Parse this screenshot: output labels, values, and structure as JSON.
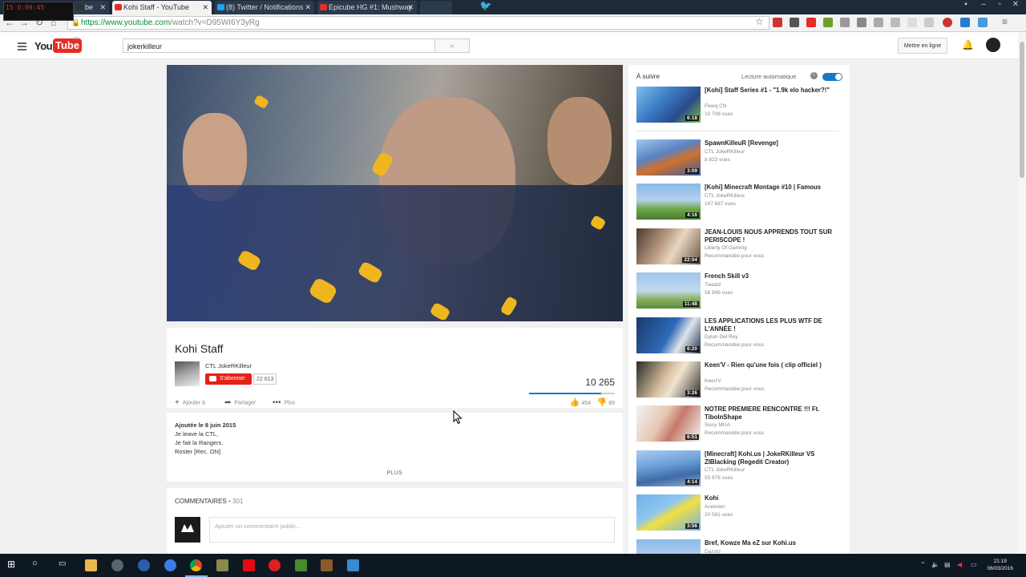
{
  "overlay": {
    "line1": "15 0:09:45"
  },
  "browser": {
    "tabs": [
      {
        "label": "be",
        "color": "#333333"
      },
      {
        "label": "Kohi Staff - YouTube",
        "color": "#e52d27"
      },
      {
        "label": "(8) Twitter / Notifications",
        "color": "#1da1f2"
      },
      {
        "label": "Epicube HG #1: Mushway",
        "color": "#e52d27"
      }
    ],
    "url_secure": "https://www.youtube.com",
    "url_rest": "/watch?v=D95WI6Y3yRg"
  },
  "youtube": {
    "logo_you": "You",
    "logo_tube": "Tube",
    "logo_region": "FR",
    "search_value": "jokerkilleur",
    "upload_label": "Mettre en ligne"
  },
  "video": {
    "title": "Kohi Staff",
    "channel": "CTL JokeRKilleur",
    "subscribe_label": "S'abonner",
    "subscriber_count": "22 613",
    "view_count": "10 265",
    "like_ratio": 0.84,
    "actions": {
      "add": "Ajouter à",
      "share": "Partager",
      "more": "Plus"
    },
    "likes": "454",
    "dislikes": "89",
    "published": "Ajoutée le 8 juin 2015",
    "description": [
      "Je leave la CTL,",
      "Je fait la Rangers.",
      "Roster [Rec. ON]"
    ],
    "more_label": "PLUS"
  },
  "comments": {
    "heading": "COMMENTAIRES",
    "count": "• 301",
    "placeholder": "Ajouter un commentaire public..."
  },
  "sidebar": {
    "up_next": "À suivre",
    "autoplay": "Lecture automatique",
    "items": [
      {
        "title": "[Kohi] Staff Series #1 - \"1.9k elo hacker?!\"",
        "channel": "Fleeq CN",
        "meta": "10 708 vues",
        "duration": "6:18",
        "thumb": "linear-gradient(135deg,#7ec0ee,#3b7bc6 40%,#2a4a8a 70%,#7ac043)"
      },
      {
        "title": "SpawnKilleuR [Revenge]",
        "channel": "CTL JokeRKilleur",
        "meta": "8 823 vues",
        "duration": "3:09",
        "thumb": "linear-gradient(160deg,#9ec8f0,#5a82c0 40%,#d2702c 60%,#3a5ea0)"
      },
      {
        "title": "[Kohi] Minecraft Montage #10 | Famous",
        "channel": "CTL JokeRKilleur",
        "meta": "147 687 vues",
        "duration": "4:16",
        "thumb": "linear-gradient(180deg,#8ab8e8,#b5d0ef 45%,#6fa84a 70%,#4b7a34)"
      },
      {
        "title": "JEAN-LOUIS NOUS APPRENDS TOUT SUR PERISCOPE !",
        "channel": "Liberty Of Gaming",
        "meta": "Recommandée pour vous",
        "duration": "22:04",
        "thumb": "linear-gradient(120deg,#4a3a30,#b99a80 40%,#e9d6c2 60%,#6a5444)"
      },
      {
        "title": "French Skill v3",
        "channel": "Tweatz",
        "meta": "56 945 vues",
        "duration": "11:48",
        "thumb": "linear-gradient(180deg,#9fc4ea,#c3d9ef 50%,#86b060 75%,#5a8a3c)"
      },
      {
        "title": "LES APPLICATIONS LES PLUS WTF DE L'ANNÉE !",
        "channel": "Dylan Del Rey",
        "meta": "Recommandée pour vous",
        "duration": "6:20",
        "thumb": "linear-gradient(120deg,#1a3a6a,#2e6ab8 50%,#e0e4ea 70%,#203050)"
      },
      {
        "title": "Keen'V - Rien qu'une fois ( clip officiel )",
        "channel": "Keen'V",
        "meta": "Recommandée pour vous",
        "duration": "3:26",
        "thumb": "linear-gradient(120deg,#2a2a2a,#d8c0a0 45%,#f0e4d0 60%,#303030)"
      },
      {
        "title": "NOTRE PREMIERE RENCONTRE !!! Ft. TiboInShape",
        "channel": "Sissy MUA",
        "meta": "Recommandée pour vous",
        "duration": "6:51",
        "thumb": "linear-gradient(120deg,#f2f2f2,#e6c7b2 40%,#c47a6a 60%,#f6f6f6)"
      },
      {
        "title": "[Minecraft] Kohi.us | JokeRKilleur VS ZIBlacking (Regedit Creator)",
        "channel": "CTL JokeRKilleur",
        "meta": "55 678 vues",
        "duration": "4:14",
        "thumb": "linear-gradient(170deg,#a8ccf0,#6ea0d8 40%,#3e6aa8 70%,#9ab0c8)"
      },
      {
        "title": "Kohi",
        "channel": "Aceester",
        "meta": "20 581 vues",
        "duration": "3:56",
        "thumb": "linear-gradient(150deg,#6fb2e8,#8ec6f0 40%,#f3e040 55%,#6fb2e8)"
      },
      {
        "title": "Bref, Kowze Ma eZ sur Kohi.us",
        "channel": "Dazotz",
        "meta": "",
        "duration": "",
        "thumb": "linear-gradient(180deg,#8ab8e8,#b5d0ef 50%,#707070)"
      }
    ]
  },
  "taskbar": {
    "time": "21:19",
    "date": "06/03/2016"
  }
}
